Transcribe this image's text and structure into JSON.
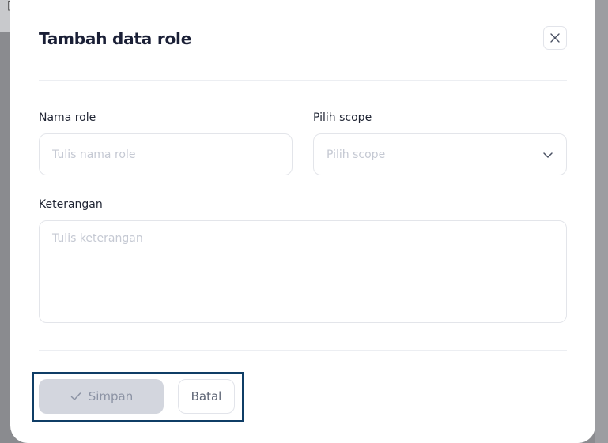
{
  "backdrop": {
    "bracket": "["
  },
  "modal": {
    "title": "Tambah data role",
    "close_icon": "close-icon"
  },
  "form": {
    "role_name": {
      "label": "Nama role",
      "placeholder": "Tulis nama role",
      "value": ""
    },
    "scope": {
      "label": "Pilih scope",
      "placeholder": "Pilih scope",
      "icon": "chevron-down-icon"
    },
    "description": {
      "label": "Keterangan",
      "placeholder": "Tulis keterangan",
      "value": ""
    }
  },
  "actions": {
    "save_label": "Simpan",
    "save_icon": "check-icon",
    "save_disabled": true,
    "cancel_label": "Batal"
  },
  "colors": {
    "focus_outline": "#0f3d66",
    "disabled_button_bg": "#d3d6de",
    "title_text": "#1a1f36"
  }
}
